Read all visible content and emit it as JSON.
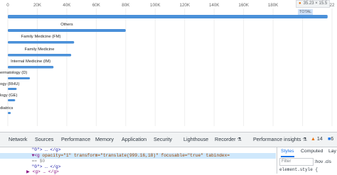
{
  "chart_data": {
    "type": "bar",
    "orientation": "horizontal",
    "x_ticks": [
      "0",
      "20K",
      "40K",
      "60K",
      "80K",
      "100K",
      "120K",
      "140K",
      "160K",
      "180K",
      "200K",
      "22"
    ],
    "x_max": 220000,
    "grid": true,
    "categories": [
      "TOTAL",
      "Others",
      "Family Medicine (FM)",
      "Family Medicine",
      "Internal Medicine (IM)",
      "ermatology (D)",
      "ogy (RHU)",
      "logy (GE)",
      "diatrics"
    ],
    "values": [
      217000,
      80000,
      45000,
      43000,
      31000,
      15000,
      6000,
      5000,
      2000
    ],
    "accent_color": "#4a90d9"
  },
  "tooltip": {
    "icon": "pin-icon",
    "text": "35.23 × 15.5"
  },
  "devtools": {
    "tabs": [
      "Network",
      "Sources",
      "Performance",
      "Memory",
      "Application",
      "Security",
      "Lighthouse",
      "Recorder ⚗",
      "Performance insights ⚗"
    ],
    "warnings": "14",
    "errors": "6",
    "elements": {
      "line0": "\"0\"> … </g>",
      "line1_tag": "▼<g",
      "line1_attrs": " opacity=\"1\" transform=\"translate(999.16,18)\" focusable=\"true\" tabindex=",
      "line1_end": "== $0",
      "line2": "\"0\"> … </g>",
      "line3": "▶ <g> … </g>"
    },
    "styles": {
      "tabs": [
        "Styles",
        "Computed",
        "Lay"
      ],
      "filter_placeholder": "Filter",
      "hov_cls": ":hov  .cls",
      "rule": "element.style {"
    }
  }
}
